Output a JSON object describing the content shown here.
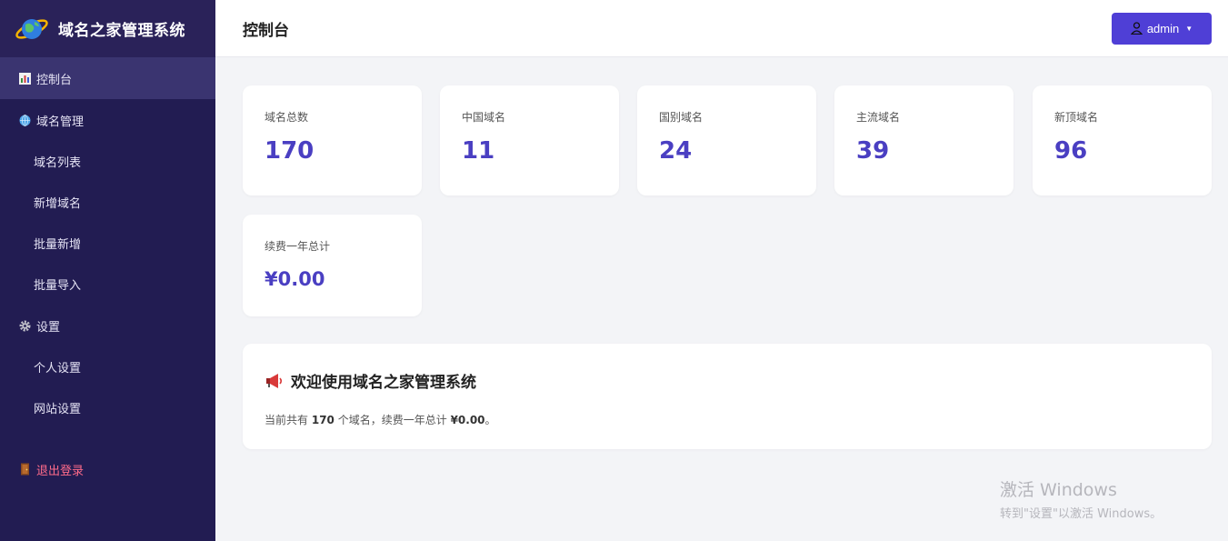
{
  "app": {
    "name": "域名之家管理系统"
  },
  "sidebar": {
    "dashboard": "控制台",
    "domain_mgmt": "域名管理",
    "domain_list": "域名列表",
    "add_domain": "新增域名",
    "batch_add": "批量新增",
    "batch_import": "批量导入",
    "settings": "设置",
    "personal_settings": "个人设置",
    "site_settings": "网站设置",
    "logout": "退出登录"
  },
  "header": {
    "title": "控制台",
    "user": "admin"
  },
  "stats": [
    {
      "label": "域名总数",
      "value": "170"
    },
    {
      "label": "中国域名",
      "value": "11"
    },
    {
      "label": "国别域名",
      "value": "24"
    },
    {
      "label": "主流域名",
      "value": "39"
    },
    {
      "label": "新顶域名",
      "value": "96"
    },
    {
      "label": "续费一年总计",
      "value": "¥0.00"
    }
  ],
  "welcome": {
    "title": "欢迎使用域名之家管理系统",
    "text_prefix": "当前共有",
    "count": "170",
    "text_mid": "个域名，续费一年总计",
    "total": "¥0.00",
    "text_suffix": "。"
  },
  "watermark": {
    "line1": "激活 Windows",
    "line2": "转到\"设置\"以激活 Windows。"
  },
  "colors": {
    "sidebar_bg": "#221c52",
    "accent": "#4f3fd6",
    "value": "#4a3fc2",
    "logout": "#ff6b8a"
  }
}
